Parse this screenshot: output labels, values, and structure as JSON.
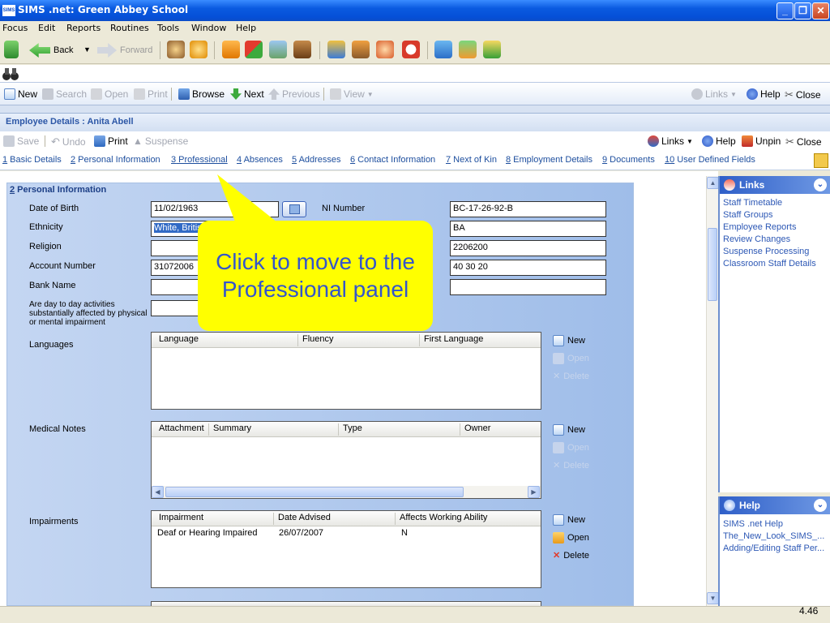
{
  "window": {
    "app_icon": "SIMS",
    "title": "SIMS .net: Green Abbey School"
  },
  "menu": [
    "Focus",
    "Edit",
    "Reports",
    "Routines",
    "Tools",
    "Window",
    "Help"
  ],
  "nav": {
    "back": "Back",
    "forward": "Forward"
  },
  "cmdbar": {
    "new": "New",
    "search": "Search",
    "open": "Open",
    "print": "Print",
    "browse": "Browse",
    "next": "Next",
    "previous": "Previous",
    "view": "View",
    "links": "Links",
    "help": "Help",
    "close": "Close"
  },
  "detail": {
    "title": "Employee Details : Anita Abell",
    "actions": {
      "save": "Save",
      "undo": "Undo",
      "print": "Print",
      "suspense": "Suspense",
      "links": "Links",
      "help": "Help",
      "unpin": "Unpin",
      "close": "Close"
    },
    "tabs": [
      {
        "num": "1",
        "label": " Basic Details"
      },
      {
        "num": "2",
        "label": " Personal Information"
      },
      {
        "num": "3",
        "label": " Professional"
      },
      {
        "num": "4",
        "label": " Absences"
      },
      {
        "num": "5",
        "label": " Addresses"
      },
      {
        "num": "6",
        "label": " Contact Information"
      },
      {
        "num": "7",
        "label": " Next of Kin"
      },
      {
        "num": "8",
        "label": " Employment Details"
      },
      {
        "num": "9",
        "label": " Documents"
      },
      {
        "num": "10",
        "label": " User Defined Fields"
      }
    ]
  },
  "personal": {
    "section_num": "2",
    "section_title": " Personal Information",
    "labels": {
      "dob": "Date of Birth",
      "ethnicity": "Ethnicity",
      "religion": "Religion",
      "account": "Account Number",
      "bank": "Bank Name",
      "impairment_q": "Are day to day activities substantially affected by physical or mental impairment",
      "ni": "NI Number",
      "languages": "Languages",
      "medical": "Medical Notes",
      "impairments": "Impairments"
    },
    "values": {
      "dob": "11/02/1963",
      "ethnicity": "White, British",
      "religion": "",
      "account": "31072006",
      "bank": "",
      "impairment_answer": "",
      "ni": "BC-17-26-92-B",
      "r2": "BA",
      "r3": "2206200",
      "r4": "40 30 20",
      "r5": ""
    },
    "languages_grid": {
      "headers": [
        "Language",
        "Fluency",
        "First Language"
      ]
    },
    "medical_grid": {
      "headers": [
        "Attachment",
        "Summary",
        "Type",
        "Owner"
      ]
    },
    "impairments_grid": {
      "headers": [
        "Impairment",
        "Date Advised",
        "Affects Working Ability"
      ],
      "rows": [
        {
          "impairment": "Deaf or Hearing Impaired",
          "date": "26/07/2007",
          "affects": "N"
        }
      ]
    },
    "side_actions": {
      "new": "New",
      "open": "Open",
      "delete": "Delete"
    }
  },
  "links_panel": {
    "title": "Links",
    "items": [
      "Staff Timetable",
      "Staff Groups",
      "Employee Reports",
      "Review Changes",
      "Suspense Processing",
      "Classroom Staff Details"
    ]
  },
  "help_panel": {
    "title": "Help",
    "items": [
      "SIMS .net Help",
      "The_New_Look_SIMS_...",
      "Adding/Editing Staff Per..."
    ]
  },
  "callout": {
    "line1": "Click to move to the",
    "line2": "Professional panel"
  },
  "slide_number": "4.46",
  "colors": {
    "title_blue": "#0550D8",
    "callout_yellow": "#FFFF00",
    "callout_text": "#3355CC",
    "link_blue": "#2D58B5"
  }
}
